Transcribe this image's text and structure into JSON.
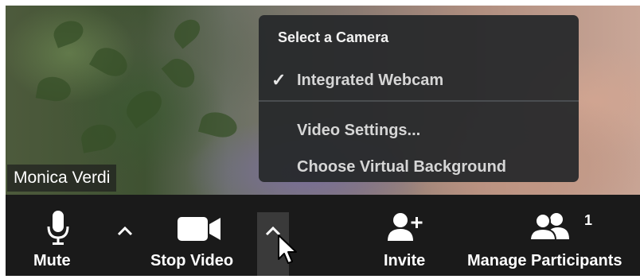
{
  "participant": {
    "name": "Monica Verdi"
  },
  "camera_menu": {
    "heading": "Select a Camera",
    "items": [
      {
        "label": "Integrated Webcam",
        "checked": true
      },
      {
        "label": "Video Settings...",
        "checked": false
      },
      {
        "label": "Choose Virtual Background",
        "checked": false
      }
    ]
  },
  "toolbar": {
    "mute_label": "Mute",
    "stop_video_label": "Stop Video",
    "invite_label": "Invite",
    "participants_label": "Manage Participants",
    "participants_count": "1"
  },
  "icons": {
    "mute": "microphone-icon",
    "video": "video-camera-icon",
    "invite": "add-person-icon",
    "participants": "people-icon",
    "caret": "chevron-up-icon"
  },
  "colors": {
    "toolbar_bg": "#1a1a1a",
    "menu_bg": "#26282a",
    "text": "#ffffff"
  }
}
